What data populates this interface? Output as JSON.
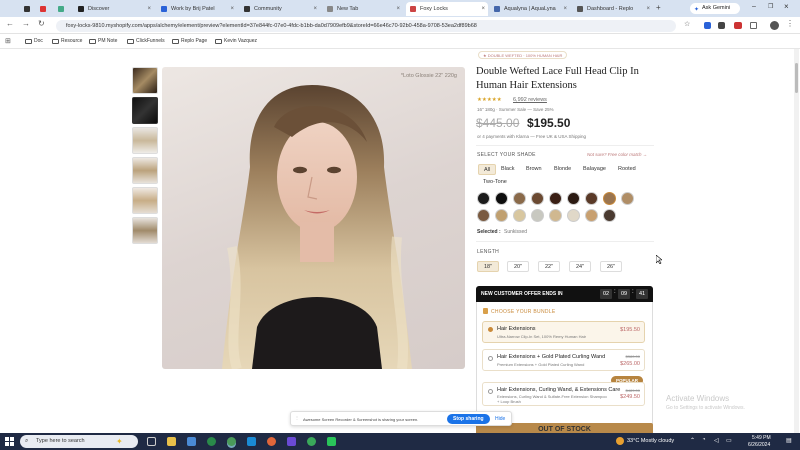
{
  "browser": {
    "tabs": [
      {
        "label": "Discover",
        "fav": "#222"
      },
      {
        "label": "Work by Brij Patel",
        "fav": "#2a62d8"
      },
      {
        "label": "Community",
        "fav": "#333"
      },
      {
        "label": "New Tab",
        "fav": "#888"
      },
      {
        "label": "Foxy Locks",
        "fav": "#c44"
      },
      {
        "label": "Aqualyna | AquaLyna",
        "fav": "#46a"
      },
      {
        "label": "Dashboard - Replo",
        "fav": "#555"
      }
    ],
    "ask_gemini": "Ask Gemini",
    "url": "foxy-locks-9810.myshopify.com/apps/alchemy/element/preview?elementId=37e844fc-07e0-4fdc-b1bb-da0d7909efb9&storeId=66e46c70-92b0-458a-9708-53ea2df89b68",
    "bookmarks": [
      "Doc",
      "Resource",
      "PM Note",
      "ClickFunnels",
      "Replo Page",
      "Kevin Vazquez"
    ]
  },
  "product": {
    "image_caption": "*Loto Glossie 22\" 220g",
    "badge": "★ DOUBLE WEFTED · 100% HUMAN HAIR",
    "title": "Double Wefted Lace Full Head Clip In Human Hair Extensions",
    "stars": "★★★★★",
    "reviews": "6,992 reviews",
    "sub": "16\" 180g · Summer Sale — Save 25%",
    "old_price": "$445.00",
    "price": "$195.50",
    "klarna": "or 4 payments with Klarna — Free UK & USA Shipping",
    "shade_label": "SELECT YOUR SHADE",
    "shade_hint": "Not sure? Free color match →",
    "shade_filters": [
      "All",
      "Black",
      "Brown",
      "Blonde",
      "Balayage",
      "Rooted",
      "Two-Tone"
    ],
    "swatch_colors": [
      "#1b1b1b",
      "#0e0e0e",
      "#8a6a4a",
      "#6b4a32",
      "#3a1f14",
      "#2b1a12",
      "#5a3a28",
      "#9a7550",
      "#b08e66",
      "#7a5a40",
      "#c0a070",
      "#d8c7a0",
      "#c8c8c0",
      "#d0b890",
      "#e0d8c8",
      "#c8a070",
      "#4a3a30"
    ],
    "selected_label": "Selected :",
    "selected_value": "Sunkissed",
    "length_label": "LENGTH",
    "lengths": [
      "18\"",
      "20\"",
      "22\"",
      "24\"",
      "26\""
    ],
    "offer_title": "NEW CUSTOMER OFFER ENDS IN",
    "timer": {
      "h": "02",
      "m": "09",
      "s": "41"
    },
    "bundle_label": "CHOOSE YOUR BUNDLE",
    "bundles": [
      {
        "title": "Hair Extensions",
        "desc": "Ultra-Narrow Clip-In Set, 100% Remy Human Hair",
        "price": "$195.50",
        "old": ""
      },
      {
        "title": "Hair Extensions + Gold Plated Curling Wand",
        "desc": "Premium Extensions + Gold Plated Curling Wand",
        "price": "$265.00",
        "old": "$380.00"
      },
      {
        "title": "Hair Extensions, Curling Wand, & Extensions Care",
        "desc": "Extensions, Curling Wand & Sulfate-Free Extension Shampoo + Loop Brush",
        "price": "$249.50",
        "old": "$489.00"
      }
    ],
    "popular_badge": "POPULAR",
    "cta": "OUT OF STOCK"
  },
  "share_bar": {
    "text": "Awesome Screen Recorder & Screenshot is sharing your screen.",
    "stop": "Stop sharing",
    "hide": "Hide"
  },
  "activate": {
    "title": "Activate Windows",
    "sub": "Go to Settings to activate Windows."
  },
  "taskbar": {
    "search": "Type here to search",
    "weather": "33°C  Mostly cloudy",
    "time": "5:49 PM",
    "date": "6/26/2024"
  }
}
